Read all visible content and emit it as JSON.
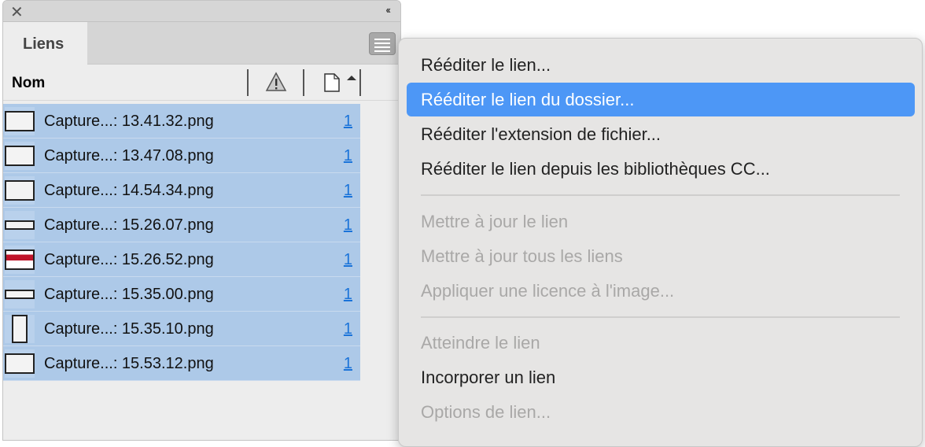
{
  "panel": {
    "tab_label": "Liens",
    "column_name": "Nom",
    "rows": [
      {
        "name": "Capture...: 13.41.32.png",
        "count": "1",
        "thumb": "wide"
      },
      {
        "name": "Capture...: 13.47.08.png",
        "count": "1",
        "thumb": "wide"
      },
      {
        "name": "Capture...: 14.54.34.png",
        "count": "1",
        "thumb": "wide"
      },
      {
        "name": "Capture...: 15.26.07.png",
        "count": "1",
        "thumb": "flat"
      },
      {
        "name": "Capture...: 15.26.52.png",
        "count": "1",
        "thumb": "red"
      },
      {
        "name": "Capture...: 15.35.00.png",
        "count": "1",
        "thumb": "flat"
      },
      {
        "name": "Capture...: 15.35.10.png",
        "count": "1",
        "thumb": "tall"
      },
      {
        "name": "Capture...: 15.53.12.png",
        "count": "1",
        "thumb": "wide"
      }
    ]
  },
  "menu": {
    "items": [
      {
        "label": "Rééditer le lien...",
        "state": "normal"
      },
      {
        "label": "Rééditer le lien du dossier...",
        "state": "highlighted"
      },
      {
        "label": "Rééditer l'extension de fichier...",
        "state": "normal"
      },
      {
        "label": "Rééditer le lien depuis les bibliothèques CC...",
        "state": "normal"
      },
      {
        "label": "Mettre à jour le lien",
        "state": "disabled"
      },
      {
        "label": "Mettre à jour tous les liens",
        "state": "disabled"
      },
      {
        "label": "Appliquer une licence à l'image...",
        "state": "disabled"
      },
      {
        "label": "Atteindre le lien",
        "state": "disabled"
      },
      {
        "label": "Incorporer un lien",
        "state": "normal"
      },
      {
        "label": "Options de lien...",
        "state": "disabled"
      }
    ]
  },
  "colors": {
    "selection": "#adc9e8",
    "highlight": "#4d97f6",
    "link": "#1a73d9"
  }
}
